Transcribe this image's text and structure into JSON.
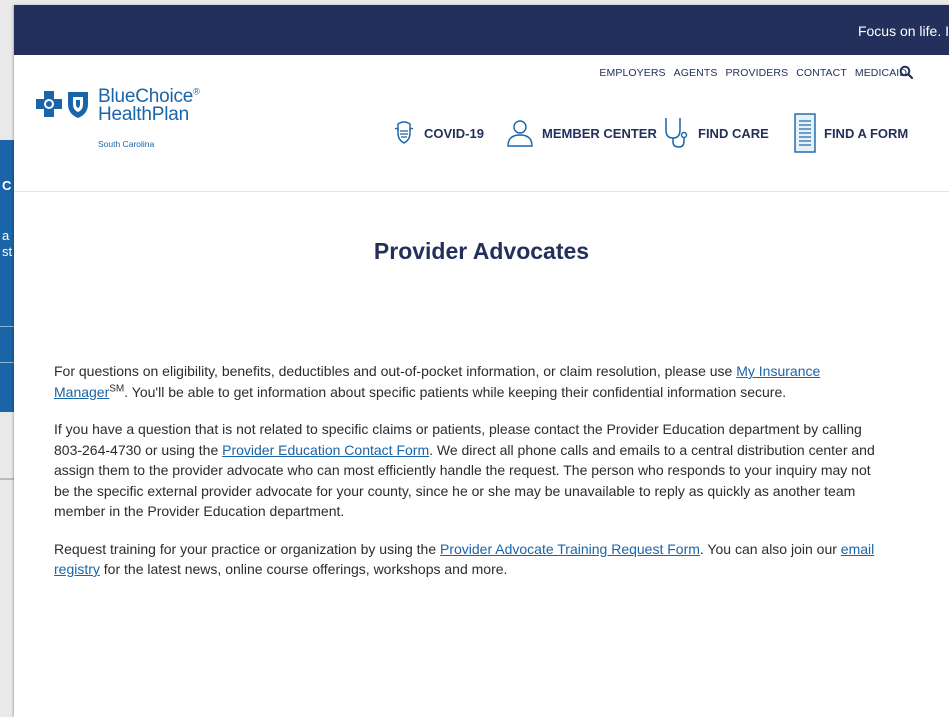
{
  "background_window": {
    "fragments": [
      "C",
      "a",
      "st"
    ]
  },
  "topbar": {
    "tagline": "Focus on life. I"
  },
  "util_nav": {
    "items": [
      "EMPLOYERS",
      "AGENTS",
      "PROVIDERS",
      "CONTACT",
      "MEDICAID"
    ]
  },
  "logo": {
    "line1": "BlueChoice",
    "line1_mark": "®",
    "line2": "HealthPlan",
    "region": "South Carolina"
  },
  "main_nav": {
    "items": [
      {
        "label": "COVID-19",
        "icon": "mask-icon"
      },
      {
        "label": "MEMBER CENTER",
        "icon": "person-icon"
      },
      {
        "label": "FIND CARE",
        "icon": "stethoscope-icon"
      },
      {
        "label": "FIND A FORM",
        "icon": "form-icon"
      }
    ]
  },
  "page": {
    "title": "Provider Advocates",
    "p1_pre": "For questions on eligibility, benefits, deductibles and out-of-pocket information, or claim resolution, please use ",
    "p1_link": "My Insurance Manager",
    "p1_sup": "SM",
    "p1_post": ". You'll be able to get information about specific patients while keeping their confidential information secure.",
    "p2_pre": "If you have a question that is not related to specific claims or patients, please contact the Provider Education department by calling 803-264-4730 or using the ",
    "p2_link": "Provider Education Contact Form",
    "p2_post": ". We direct all phone calls and emails to a central distribution center and assign them to the provider advocate who can most efficiently handle the request. The person who responds to your inquiry may not be the specific external provider advocate for your county, since he or she may be unavailable to reply as quickly as another team member in the Provider Education department.",
    "p3_pre": "Request training for your practice or organization by using the ",
    "p3_link": "Provider Advocate Training Request Form",
    "p3_mid": ". You can also join our ",
    "p3_link2": "email registry",
    "p3_post": " for the latest news, online course offerings, workshops and more."
  },
  "colors": {
    "navy": "#23305c",
    "blue": "#1a64a8"
  }
}
